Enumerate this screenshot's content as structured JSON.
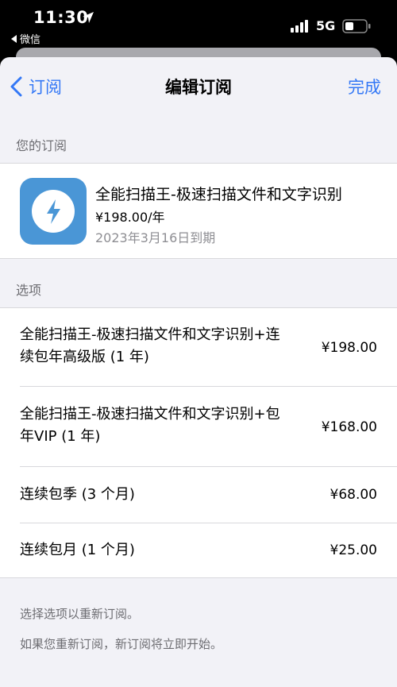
{
  "status_bar": {
    "time": "11:30",
    "back_app": "微信",
    "network": "5G"
  },
  "nav": {
    "back_label": "订阅",
    "title": "编辑订阅",
    "done_label": "完成"
  },
  "current": {
    "header": "您的订阅",
    "app_name": "全能扫描王-极速扫描文件和文字识别",
    "price": "¥198.00/年",
    "expire": "2023年3月16日到期",
    "icon_color": "#4a96d6"
  },
  "options": {
    "header": "选项",
    "items": [
      {
        "line1": "全能扫描王-极速扫描文件和文字识别+连",
        "line2": "续包年高级版 (1 年)",
        "price": "¥198.00"
      },
      {
        "line1": "全能扫描王-极速扫描文件和文字识别+包",
        "line2": "年VIP (1 年)",
        "price": "¥168.00"
      },
      {
        "line1": "连续包季 (3 个月)",
        "price": "¥68.00"
      },
      {
        "line1": "连续包月 (1 个月)",
        "price": "¥25.00"
      }
    ]
  },
  "footer": {
    "note1": "选择选项以重新订阅。",
    "note2": "如果您重新订阅，新订阅将立即开始。"
  },
  "colors": {
    "accent": "#3478f6",
    "background": "#f2f2f7"
  }
}
